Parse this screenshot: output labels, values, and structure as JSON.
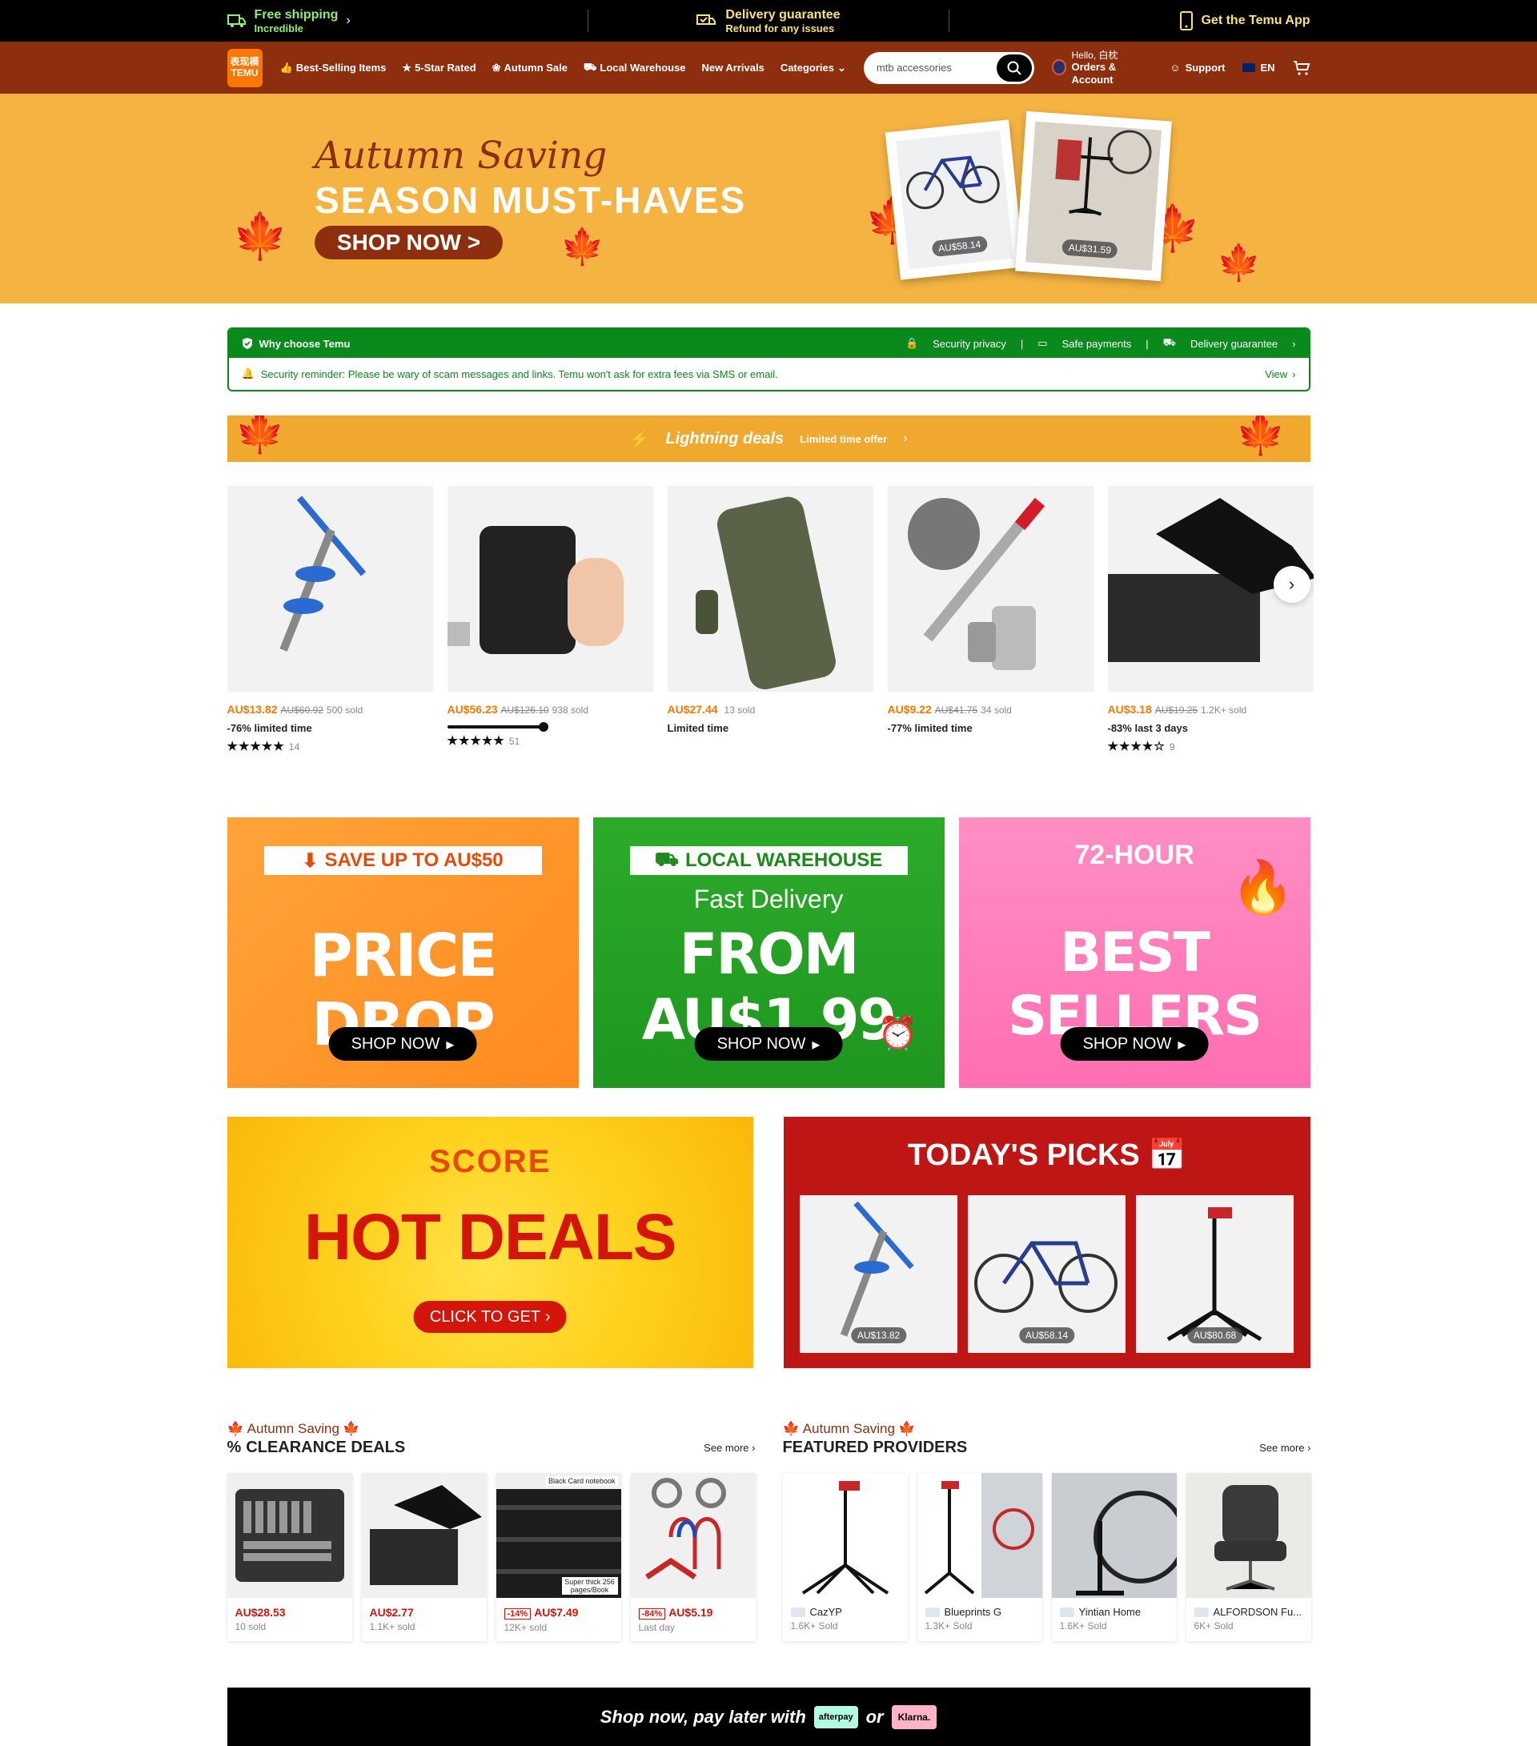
{
  "topbar": {
    "shipping_title": "Free shipping",
    "shipping_sub": "Incredible",
    "delivery_title": "Delivery guarantee",
    "delivery_sub": "Refund for any issues",
    "app": "Get the Temu App"
  },
  "nav": {
    "logo_line1": "表现模",
    "logo_line2": "TEMU",
    "links": [
      "Best-Selling Items",
      "5-Star Rated",
      "Autumn Sale",
      "Local Warehouse",
      "New Arrivals",
      "Categories"
    ],
    "search_value": "mtb accessories",
    "hello": "Hello, 白枕",
    "orders": "Orders & Account",
    "support": "Support",
    "lang": "EN"
  },
  "hero": {
    "title1": "Autumn Saving",
    "title2": "SEASON MUST-HAVES",
    "button": "SHOP NOW >",
    "price1": "AU$58.14",
    "price2": "AU$31.59"
  },
  "why": {
    "title": "Why choose Temu",
    "items": [
      "Security privacy",
      "Safe payments",
      "Delivery guarantee"
    ],
    "reminder": "Security reminder: Please be wary of scam messages and links. Temu won't ask for extra fees via SMS or email.",
    "view": "View"
  },
  "lightning": {
    "title": "Lightning deals",
    "sub": "Limited time offer"
  },
  "deals": [
    {
      "price": "AU$13.82",
      "was": "AU$60.92",
      "sold": "500 sold",
      "tag": "-76% limited time",
      "stars": "★★★★★",
      "reviews": "14"
    },
    {
      "price": "AU$56.23",
      "was": "AU$126.10",
      "sold": "938 sold",
      "tag": "",
      "stars": "★★★★★",
      "reviews": "51"
    },
    {
      "price": "AU$27.44",
      "was": "",
      "sold": "13 sold",
      "tag": "Limited time",
      "stars": "",
      "reviews": ""
    },
    {
      "price": "AU$9.22",
      "was": "AU$41.75",
      "sold": "34 sold",
      "tag": "-77% limited time",
      "stars": "",
      "reviews": ""
    },
    {
      "price": "AU$3.18",
      "was": "AU$19.25",
      "sold": "1.2K+ sold",
      "tag": "-83% last 3 days",
      "stars": "★★★★☆",
      "reviews": "9"
    }
  ],
  "promos": {
    "p1_box": "SAVE UP TO AU$50",
    "p1_big": "PRICE DROP",
    "p1_btn": "SHOP NOW",
    "p2_box": "LOCAL WAREHOUSE",
    "p2_mid": "Fast Delivery",
    "p2_big": "FROM AU$1.99",
    "p2_btn": "SHOP NOW",
    "p3_top": "72-HOUR",
    "p3_big": "BEST SELLERS",
    "p3_btn": "SHOP NOW"
  },
  "hot": {
    "score": "SCORE",
    "title": "HOT DEALS",
    "button": "CLICK TO GET"
  },
  "picks": {
    "title": "TODAY'S PICKS",
    "prices": [
      "AU$13.82",
      "AU$58.14",
      "AU$80.68"
    ]
  },
  "clearance": {
    "sub": "Autumn Saving",
    "title": "CLEARANCE DEALS",
    "see_more": "See more",
    "cards": [
      {
        "price": "AU$28.53",
        "disc": "",
        "sold": "10 sold"
      },
      {
        "price": "AU$2.77",
        "disc": "",
        "sold": "1.1K+ sold"
      },
      {
        "price": "AU$7.49",
        "disc": "-14%",
        "sold": "12K+ sold"
      },
      {
        "price": "AU$5.19",
        "disc": "-84%",
        "sold": "Last day"
      }
    ],
    "notebook_label": "Black Card notebook",
    "notebook_label2": "Super thick 256 pages/Book"
  },
  "providers": {
    "sub": "Autumn Saving",
    "title": "FEATURED PROVIDERS",
    "see_more": "See more",
    "cards": [
      {
        "name": "CazYP",
        "sold": "1.6K+ Sold"
      },
      {
        "name": "Blueprints G",
        "sold": "1.3K+ Sold"
      },
      {
        "name": "Yintian Home",
        "sold": "1.6K+ Sold"
      },
      {
        "name": "ALFORDSON Fu...",
        "sold": "6K+ Sold"
      }
    ]
  },
  "paylater": {
    "text": "Shop now, pay later with",
    "or": "or",
    "afterpay": "afterpay",
    "klarna": "Klarna."
  },
  "colors": {
    "brand_orange": "#fb7701",
    "nav_brown": "#8d2f0f",
    "trust_green": "#0a8a1d",
    "sale_red": "#d4150a"
  }
}
